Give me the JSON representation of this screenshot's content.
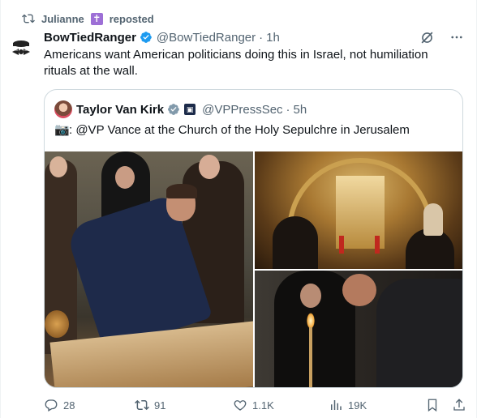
{
  "repost": {
    "user": "Julianne",
    "label": "reposted"
  },
  "post": {
    "author_name": "BowTiedRanger",
    "author_handle": "@BowTiedRanger",
    "time": "1h",
    "text": "Americans want American politicians doing this in Israel, not humiliation rituals at the wall."
  },
  "quote": {
    "author_name": "Taylor Van Kirk",
    "author_handle": "@VPPressSec",
    "time": "5h",
    "text": ": @VP Vance at the Church of the Holy Sepulchre in Jerusalem"
  },
  "actions": {
    "replies": "28",
    "reposts": "91",
    "likes": "1.1K",
    "views": "19K"
  },
  "colors": {
    "verified": "#1d9bf0",
    "muted": "#536471",
    "text": "#0f1419",
    "border": "#cfd9de"
  }
}
